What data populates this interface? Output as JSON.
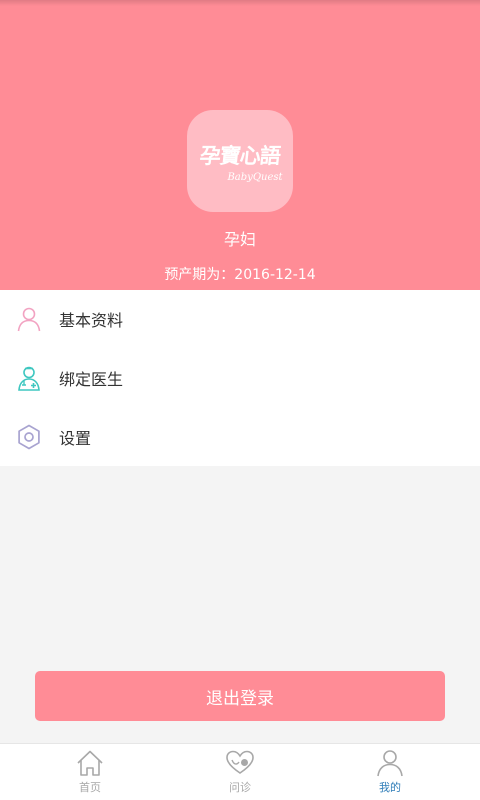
{
  "colors": {
    "accent": "#ff8c96",
    "avatar_bg": "#ffbcc4",
    "page_bg": "#f4f4f4",
    "active_tab": "#2f7db8",
    "inactive_tab": "#a8a8a8"
  },
  "profile": {
    "logo_text": "孕寶心語",
    "logo_sub": "BabyQuest",
    "name": "孕妇",
    "due_date": "预产期为：2016-12-14"
  },
  "menu": {
    "items": [
      {
        "label": "基本资料",
        "icon": "user-icon"
      },
      {
        "label": "绑定医生",
        "icon": "doctor-icon"
      },
      {
        "label": "设置",
        "icon": "settings-icon"
      }
    ]
  },
  "logout_label": "退出登录",
  "tabs": [
    {
      "label": "首页",
      "icon": "home-icon",
      "active": false
    },
    {
      "label": "问诊",
      "icon": "heart-stethoscope-icon",
      "active": false
    },
    {
      "label": "我的",
      "icon": "profile-icon",
      "active": true
    }
  ]
}
